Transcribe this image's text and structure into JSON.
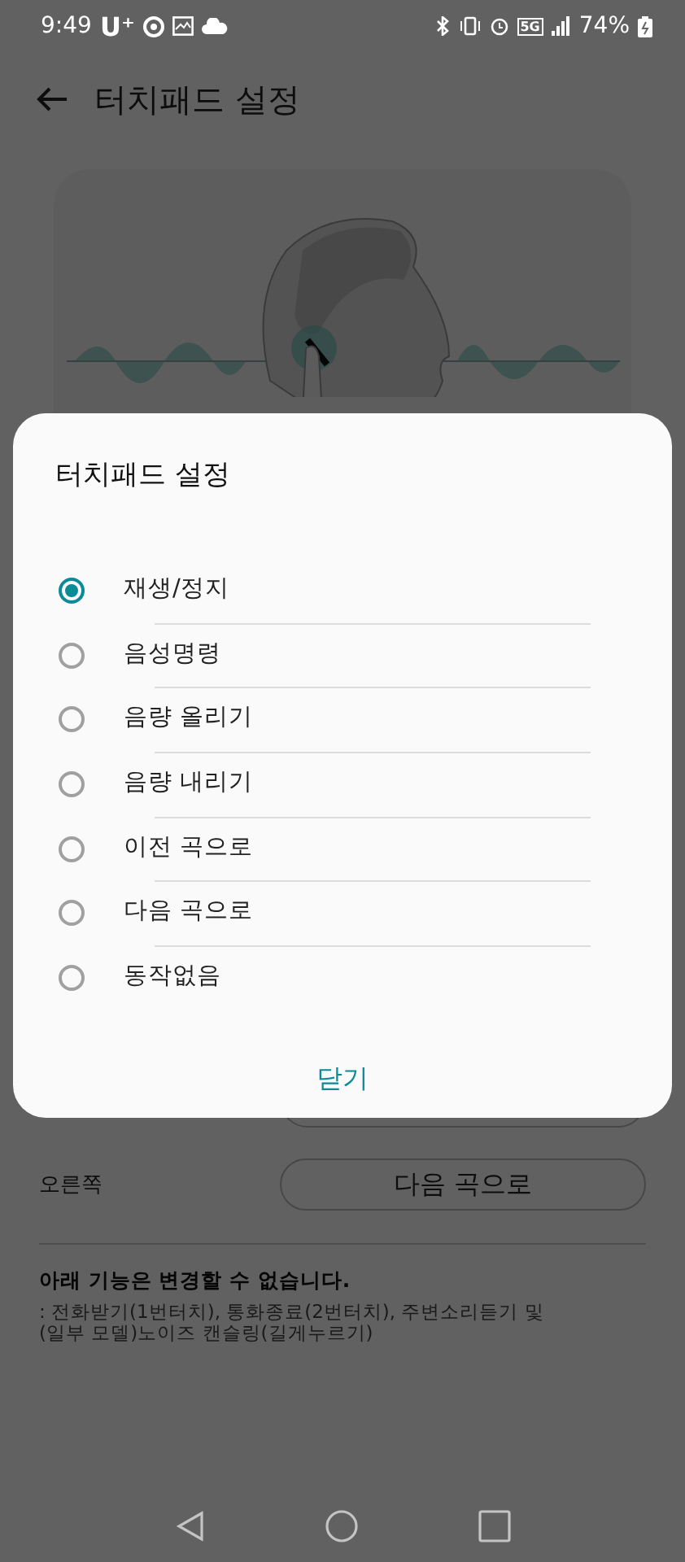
{
  "status_bar": {
    "time": "9:49",
    "carrier": "U⁺",
    "network": "5G",
    "battery": "74%"
  },
  "header": {
    "title": "터치패드 설정"
  },
  "settings": [
    {
      "label": "오른쪽",
      "value": "다음 곡으로"
    }
  ],
  "note": {
    "title": "아래 기능은 변경할 수 없습니다.",
    "text": ": 전화받기(1번터치), 통화종료(2번터치), 주변소리듣기 및 (일부 모델)노이즈 캔슬링(길게누르기)"
  },
  "dialog": {
    "title": "터치패드 설정",
    "options": [
      {
        "label": "재생/정지",
        "selected": true
      },
      {
        "label": "음성명령",
        "selected": false
      },
      {
        "label": "음량 올리기",
        "selected": false
      },
      {
        "label": "음량 내리기",
        "selected": false
      },
      {
        "label": "이전 곡으로",
        "selected": false
      },
      {
        "label": "다음 곡으로",
        "selected": false
      },
      {
        "label": "동작없음",
        "selected": false
      }
    ],
    "close": "닫기"
  }
}
